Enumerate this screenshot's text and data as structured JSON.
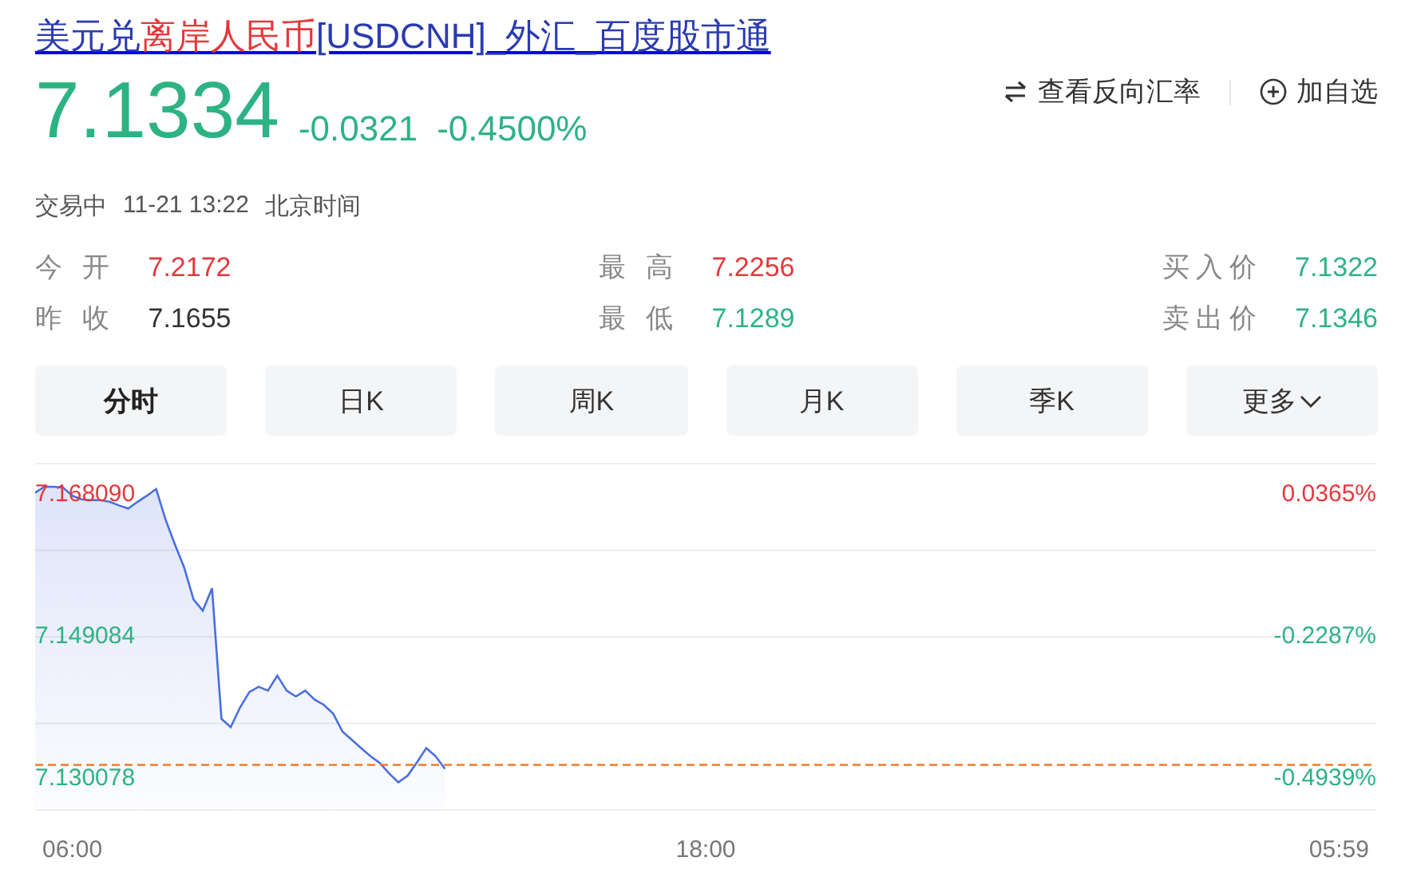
{
  "title": {
    "parts": [
      {
        "text": "美元兑",
        "color": "#2a3bb0"
      },
      {
        "text": "离岸人民币",
        "color": "#e5383b"
      },
      {
        "text": "[USDCNH]_外汇_百度股市通",
        "color": "#2a3bb0"
      }
    ]
  },
  "quote": {
    "price": "7.1334",
    "change": "-0.0321",
    "change_percent": "-0.4500%",
    "color": "#2db383",
    "status": "交易中",
    "time": "11-21 13:22",
    "timezone": "北京时间"
  },
  "actions": [
    {
      "label": "查看反向汇率"
    },
    {
      "label": "加自选"
    }
  ],
  "stats": [
    [
      {
        "label": "今 开",
        "value": "7.2172",
        "color": "#e5383b"
      },
      {
        "label": "昨 收",
        "value": "7.1655",
        "color": "#333333"
      }
    ],
    [
      {
        "label": "最 高",
        "value": "7.2256",
        "color": "#e5383b"
      },
      {
        "label": "最 低",
        "value": "7.1289",
        "color": "#2db383"
      }
    ],
    [
      {
        "label": "买入价",
        "value": "7.1322",
        "color": "#2db383"
      },
      {
        "label": "卖出价",
        "value": "7.1346",
        "color": "#2db383"
      }
    ]
  ],
  "tabs": [
    {
      "label": "分时",
      "selected": true,
      "kind": "tab"
    },
    {
      "label": "日K",
      "selected": false,
      "kind": "tab"
    },
    {
      "label": "周K",
      "selected": false,
      "kind": "tab"
    },
    {
      "label": "月K",
      "selected": false,
      "kind": "tab"
    },
    {
      "label": "季K",
      "selected": false,
      "kind": "tab"
    },
    {
      "label": "更多",
      "selected": false,
      "kind": "dropdown"
    }
  ],
  "chart": {
    "percent_labels": [
      {
        "label": "0.0365%",
        "color": "#e5383b"
      },
      {
        "label": "-0.2287%",
        "color": "#2db383"
      },
      {
        "label": "-0.4939%",
        "color": "#2db383"
      }
    ],
    "chart_data": {
      "type": "area",
      "categories": [
        null,
        null,
        null,
        null,
        "06:00",
        null,
        null,
        null,
        null,
        null,
        null,
        null,
        null,
        null,
        null,
        null,
        null,
        null,
        null,
        null,
        null,
        null,
        null,
        null,
        null,
        null,
        null,
        null,
        null,
        null,
        null,
        null,
        null,
        null,
        null,
        null,
        null,
        null,
        null,
        null,
        null,
        null,
        null,
        null,
        null,
        null,
        null,
        null,
        null,
        null,
        null,
        null,
        null,
        null,
        null,
        null,
        null,
        null,
        null,
        null,
        null,
        null,
        null,
        null,
        null,
        null,
        null,
        null,
        null,
        null,
        null,
        null,
        "18:00",
        null,
        null,
        null,
        null,
        null,
        null,
        null,
        null,
        null,
        null,
        null,
        null,
        null,
        null,
        null,
        null,
        null,
        null,
        null,
        null,
        null,
        null,
        null,
        null,
        null,
        null,
        null,
        null,
        null,
        null,
        null,
        null,
        null,
        null,
        null,
        null,
        null,
        null,
        null,
        null,
        null,
        null,
        null,
        null,
        null,
        null,
        null,
        null,
        null,
        null,
        null,
        null,
        null,
        null,
        null,
        null,
        null,
        null,
        null,
        null,
        null,
        null,
        null,
        null,
        null,
        null,
        null,
        "05:59",
        null,
        null,
        null,
        null
      ],
      "series": [
        {
          "color": "#4a6ee0",
          "values": [
            7.1685,
            7.1693,
            7.1693,
            7.1692,
            7.1681,
            7.1676,
            7.1675,
            7.1675,
            7.1673,
            7.1668,
            7.1664,
            7.1673,
            7.1681,
            7.169,
            7.1649,
            7.1616,
            7.1585,
            7.1542,
            7.1527,
            7.1557,
            7.1382,
            7.1371,
            7.1397,
            7.1418,
            7.1425,
            7.142,
            7.144,
            7.142,
            7.1412,
            7.142,
            7.1408,
            7.1401,
            7.1389,
            7.1365,
            7.1354,
            7.1343,
            7.1332,
            7.1323,
            7.1309,
            7.1297,
            7.1306,
            7.1324,
            7.1343,
            7.1332,
            7.1315,
            null,
            null,
            null,
            null,
            null,
            null,
            null,
            null,
            null,
            null,
            null,
            null,
            null,
            null,
            null,
            null,
            null,
            null,
            null,
            null,
            null,
            null,
            null,
            null,
            null,
            null,
            null,
            null,
            null,
            null,
            null,
            null,
            null,
            null,
            null,
            null,
            null,
            null,
            null,
            null,
            null,
            null,
            null,
            null,
            null,
            null,
            null,
            null,
            null,
            null,
            null,
            null,
            null,
            null,
            null,
            null,
            null,
            null,
            null,
            null,
            null,
            null,
            null,
            null,
            null,
            null,
            null,
            null,
            null,
            null,
            null,
            null,
            null,
            null,
            null,
            null,
            null,
            null,
            null,
            null,
            null,
            null,
            null,
            null,
            null,
            null,
            null,
            null,
            null,
            null,
            null,
            null,
            null,
            null,
            null,
            null,
            null,
            null,
            null,
            null
          ]
        }
      ],
      "ylim": [
        7.126,
        7.1724
      ],
      "yticks": [
        {
          "value": 7.16809,
          "label": "7.168090"
        },
        {
          "value": 7.149084,
          "label": "7.149084"
        },
        {
          "value": 7.130078,
          "label": "7.130078"
        }
      ]
    }
  }
}
